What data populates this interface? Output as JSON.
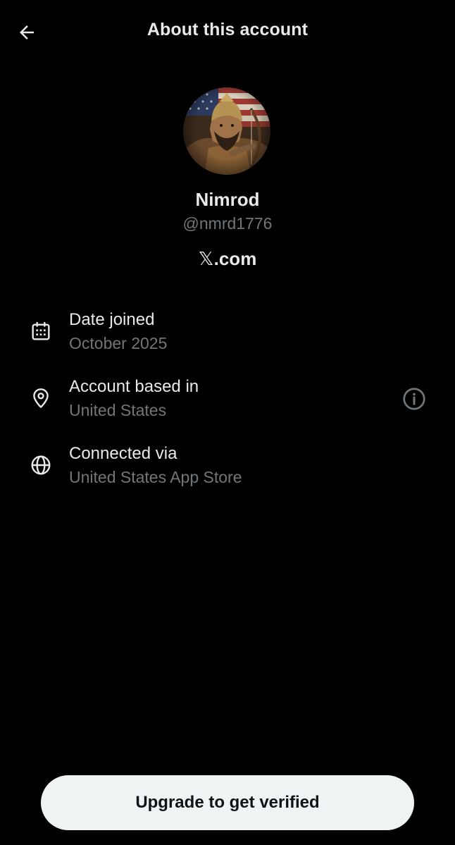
{
  "header": {
    "title": "About this account",
    "back_icon": "arrow-left-icon"
  },
  "profile": {
    "display_name": "Nimrod",
    "handle": "@nmrd1776",
    "site_prefix": "𝕏",
    "site_suffix": ".com"
  },
  "details": [
    {
      "icon": "calendar-icon",
      "label": "Date joined",
      "value": "October 2025"
    },
    {
      "icon": "location-pin-icon",
      "label": "Account based in",
      "value": "United States",
      "trailing_icon": "info-icon"
    },
    {
      "icon": "globe-icon",
      "label": "Connected via",
      "value": "United States App Store"
    }
  ],
  "cta": {
    "label": "Upgrade to get verified"
  },
  "colors": {
    "background": "#000000",
    "primary_text": "#e7e9ea",
    "secondary_text": "#71767b",
    "button_bg": "#eff3f4",
    "button_text": "#0f1419"
  }
}
